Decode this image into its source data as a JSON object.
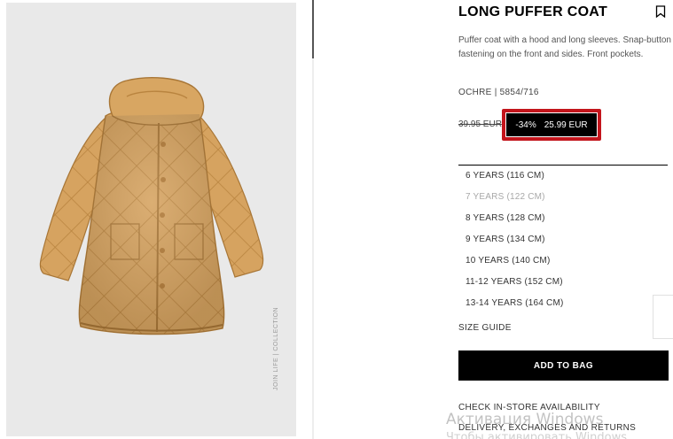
{
  "product": {
    "title": "LONG PUFFER COAT",
    "description": "Puffer coat with a hood and long sleeves. Snap-button fastening on the front and sides. Front pockets.",
    "color_ref": "OCHRE | 5854/716",
    "old_price": "39.95 EUR",
    "discount": "-34%",
    "price": "25.99 EUR",
    "accent_color": "#c3151c",
    "coat_color": "#d9a866"
  },
  "photo": {
    "caption": "JOIN LIFE | COLLECTION"
  },
  "sizes": [
    {
      "label": "6 YEARS (116 CM)",
      "available": true
    },
    {
      "label": "7 YEARS (122 CM)",
      "available": false
    },
    {
      "label": "8 YEARS (128 CM)",
      "available": true
    },
    {
      "label": "9 YEARS (134 CM)",
      "available": true
    },
    {
      "label": "10 YEARS (140 CM)",
      "available": true
    },
    {
      "label": "11-12 YEARS (152 CM)",
      "available": true
    },
    {
      "label": "13-14 YEARS (164 CM)",
      "available": true
    }
  ],
  "actions": {
    "size_guide": "SIZE GUIDE",
    "add_to_bag": "ADD TO BAG",
    "store_availability": "CHECK IN-STORE AVAILABILITY",
    "delivery": "DELIVERY, EXCHANGES AND RETURNS"
  },
  "os_overlay": {
    "watermark": "Активация Windows",
    "watermark_sub": "Чтобы активировать Windows"
  },
  "icons": {
    "bookmark": "bookmark-icon"
  }
}
